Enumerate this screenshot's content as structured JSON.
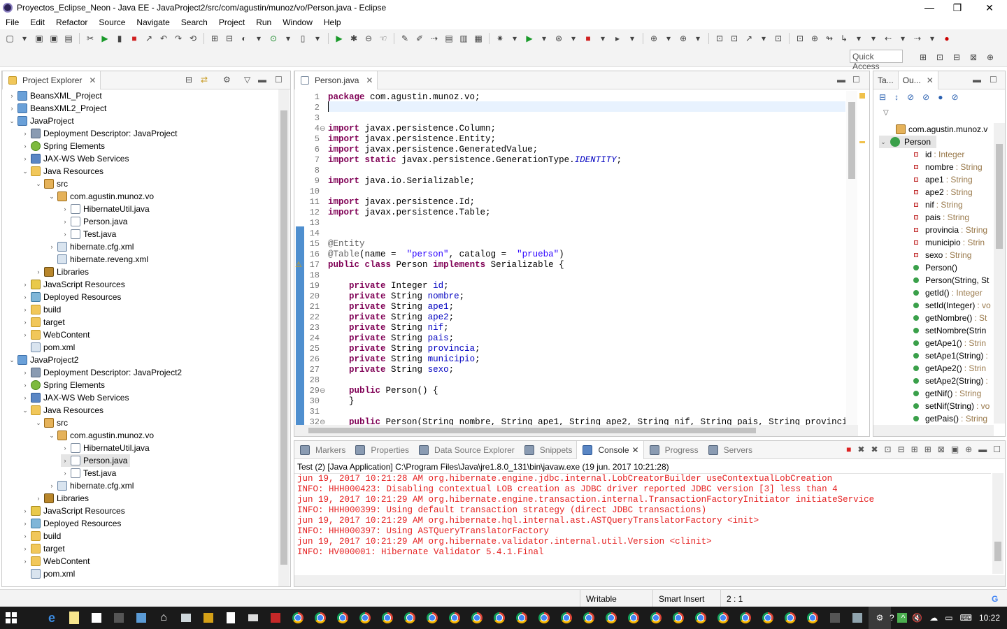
{
  "window": {
    "title": "Proyectos_Eclipse_Neon - Java EE - JavaProject2/src/com/agustin/munoz/vo/Person.java - Eclipse",
    "minimize": "—",
    "maximize": "❐",
    "close": "✕"
  },
  "menu": [
    "File",
    "Edit",
    "Refactor",
    "Source",
    "Navigate",
    "Search",
    "Project",
    "Run",
    "Window",
    "Help"
  ],
  "quick_access": "Quick Access",
  "project_explorer": {
    "tab": "Project Explorer",
    "items": [
      {
        "label": "BeansXML_Project",
        "depth": 0,
        "tw": "›",
        "icon": "proj"
      },
      {
        "label": "BeansXML2_Project",
        "depth": 0,
        "tw": "›",
        "icon": "proj"
      },
      {
        "label": "JavaProject",
        "depth": 0,
        "tw": "⌄",
        "icon": "proj"
      },
      {
        "label": "Deployment Descriptor: JavaProject",
        "depth": 1,
        "tw": "›",
        "icon": "dd"
      },
      {
        "label": "Spring Elements",
        "depth": 1,
        "tw": "›",
        "icon": "spring"
      },
      {
        "label": "JAX-WS Web Services",
        "depth": 1,
        "tw": "›",
        "icon": "ws"
      },
      {
        "label": "Java Resources",
        "depth": 1,
        "tw": "⌄",
        "icon": "folder"
      },
      {
        "label": "src",
        "depth": 2,
        "tw": "⌄",
        "icon": "pkg"
      },
      {
        "label": "com.agustin.munoz.vo",
        "depth": 3,
        "tw": "⌄",
        "icon": "pkg"
      },
      {
        "label": "HibernateUtil.java",
        "depth": 4,
        "tw": "›",
        "icon": "java"
      },
      {
        "label": "Person.java",
        "depth": 4,
        "tw": "›",
        "icon": "java"
      },
      {
        "label": "Test.java",
        "depth": 4,
        "tw": "›",
        "icon": "java"
      },
      {
        "label": "hibernate.cfg.xml",
        "depth": 3,
        "tw": "›",
        "icon": "xml"
      },
      {
        "label": "hibernate.reveng.xml",
        "depth": 3,
        "tw": "",
        "icon": "xml"
      },
      {
        "label": "Libraries",
        "depth": 2,
        "tw": "›",
        "icon": "lib"
      },
      {
        "label": "JavaScript Resources",
        "depth": 1,
        "tw": "›",
        "icon": "js"
      },
      {
        "label": "Deployed Resources",
        "depth": 1,
        "tw": "›",
        "icon": "dep"
      },
      {
        "label": "build",
        "depth": 1,
        "tw": "›",
        "icon": "folder"
      },
      {
        "label": "target",
        "depth": 1,
        "tw": "›",
        "icon": "folder"
      },
      {
        "label": "WebContent",
        "depth": 1,
        "tw": "›",
        "icon": "folder"
      },
      {
        "label": "pom.xml",
        "depth": 1,
        "tw": "",
        "icon": "xml"
      },
      {
        "label": "JavaProject2",
        "depth": 0,
        "tw": "⌄",
        "icon": "proj"
      },
      {
        "label": "Deployment Descriptor: JavaProject2",
        "depth": 1,
        "tw": "›",
        "icon": "dd"
      },
      {
        "label": "Spring Elements",
        "depth": 1,
        "tw": "›",
        "icon": "spring"
      },
      {
        "label": "JAX-WS Web Services",
        "depth": 1,
        "tw": "›",
        "icon": "ws"
      },
      {
        "label": "Java Resources",
        "depth": 1,
        "tw": "⌄",
        "icon": "folder"
      },
      {
        "label": "src",
        "depth": 2,
        "tw": "⌄",
        "icon": "pkg"
      },
      {
        "label": "com.agustin.munoz.vo",
        "depth": 3,
        "tw": "⌄",
        "icon": "pkg"
      },
      {
        "label": "HibernateUtil.java",
        "depth": 4,
        "tw": "›",
        "icon": "java"
      },
      {
        "label": "Person.java",
        "depth": 4,
        "tw": "›",
        "icon": "java",
        "selected": true
      },
      {
        "label": "Test.java",
        "depth": 4,
        "tw": "›",
        "icon": "java"
      },
      {
        "label": "hibernate.cfg.xml",
        "depth": 3,
        "tw": "›",
        "icon": "xml"
      },
      {
        "label": "Libraries",
        "depth": 2,
        "tw": "›",
        "icon": "lib"
      },
      {
        "label": "JavaScript Resources",
        "depth": 1,
        "tw": "›",
        "icon": "js"
      },
      {
        "label": "Deployed Resources",
        "depth": 1,
        "tw": "›",
        "icon": "dep"
      },
      {
        "label": "build",
        "depth": 1,
        "tw": "›",
        "icon": "folder"
      },
      {
        "label": "target",
        "depth": 1,
        "tw": "›",
        "icon": "folder"
      },
      {
        "label": "WebContent",
        "depth": 1,
        "tw": "›",
        "icon": "folder"
      },
      {
        "label": "pom.xml",
        "depth": 1,
        "tw": "",
        "icon": "xml"
      }
    ]
  },
  "editor": {
    "tab": "Person.java",
    "lines": [
      [
        [
          "kw",
          "package"
        ],
        [
          "",
          "com.agustin.munoz.vo;"
        ]
      ],
      [],
      [],
      [
        [
          "kw",
          "import"
        ],
        [
          "",
          "javax.persistence.Column;"
        ]
      ],
      [
        [
          "kw",
          "import"
        ],
        [
          "",
          "javax.persistence.Entity;"
        ]
      ],
      [
        [
          "kw",
          "import"
        ],
        [
          "",
          "javax.persistence.GeneratedValue;"
        ]
      ],
      [
        [
          "kw",
          "import"
        ],
        [
          "kw",
          "static"
        ],
        [
          "",
          "javax.persistence.GenerationType."
        ],
        [
          "ital",
          "IDENTITY"
        ],
        [
          "",
          ";"
        ]
      ],
      [],
      [
        [
          "kw",
          "import"
        ],
        [
          "",
          "java.io.Serializable;"
        ]
      ],
      [],
      [
        [
          "kw",
          "import"
        ],
        [
          "",
          "javax.persistence.Id;"
        ]
      ],
      [
        [
          "kw",
          "import"
        ],
        [
          "",
          "javax.persistence.Table;"
        ]
      ],
      [],
      [],
      [
        [
          "ann",
          "@Entity"
        ]
      ],
      [
        [
          "ann",
          "@Table"
        ],
        [
          "",
          "(name = "
        ],
        [
          "str",
          "\"person\""
        ],
        [
          "",
          ", catalog = "
        ],
        [
          "str",
          "\"prueba\""
        ],
        [
          "",
          ")"
        ]
      ],
      [
        [
          "kw",
          "public class"
        ],
        [
          "",
          "Person"
        ],
        [
          "kw",
          "implements"
        ],
        [
          "",
          "Serializable {"
        ]
      ],
      [],
      [
        [
          "",
          "    "
        ],
        [
          "kw",
          "private"
        ],
        [
          "",
          "Integer"
        ],
        [
          "fld",
          "id"
        ],
        [
          "",
          ";"
        ]
      ],
      [
        [
          "",
          "    "
        ],
        [
          "kw",
          "private"
        ],
        [
          "",
          "String"
        ],
        [
          "fld",
          "nombre"
        ],
        [
          "",
          ";"
        ]
      ],
      [
        [
          "",
          "    "
        ],
        [
          "kw",
          "private"
        ],
        [
          "",
          "String"
        ],
        [
          "fld",
          "ape1"
        ],
        [
          "",
          ";"
        ]
      ],
      [
        [
          "",
          "    "
        ],
        [
          "kw",
          "private"
        ],
        [
          "",
          "String"
        ],
        [
          "fld",
          "ape2"
        ],
        [
          "",
          ";"
        ]
      ],
      [
        [
          "",
          "    "
        ],
        [
          "kw",
          "private"
        ],
        [
          "",
          "String"
        ],
        [
          "fld",
          "nif"
        ],
        [
          "",
          ";"
        ]
      ],
      [
        [
          "",
          "    "
        ],
        [
          "kw",
          "private"
        ],
        [
          "",
          "String"
        ],
        [
          "fld",
          "pais"
        ],
        [
          "",
          ";"
        ]
      ],
      [
        [
          "",
          "    "
        ],
        [
          "kw",
          "private"
        ],
        [
          "",
          "String"
        ],
        [
          "fld",
          "provincia"
        ],
        [
          "",
          ";"
        ]
      ],
      [
        [
          "",
          "    "
        ],
        [
          "kw",
          "private"
        ],
        [
          "",
          "String"
        ],
        [
          "fld",
          "municipio"
        ],
        [
          "",
          ";"
        ]
      ],
      [
        [
          "",
          "    "
        ],
        [
          "kw",
          "private"
        ],
        [
          "",
          "String"
        ],
        [
          "fld",
          "sexo"
        ],
        [
          "",
          ";"
        ]
      ],
      [],
      [
        [
          "",
          "    "
        ],
        [
          "kw",
          "public"
        ],
        [
          "",
          "Person() {"
        ]
      ],
      [
        [
          "",
          "    }"
        ]
      ],
      [],
      [
        [
          "",
          "    "
        ],
        [
          "kw",
          "public"
        ],
        [
          "",
          "Person(String nombre, String ape1, String ape2, String nif, String pais, String provincia, Stri"
        ]
      ]
    ]
  },
  "outline": {
    "tab_tasks": "Ta...",
    "tab": "Ou...",
    "package": "com.agustin.munoz.v",
    "class": "Person",
    "members": [
      {
        "kind": "field",
        "name": "id",
        "type": ": Integer"
      },
      {
        "kind": "field",
        "name": "nombre",
        "type": ": String"
      },
      {
        "kind": "field",
        "name": "ape1",
        "type": ": String"
      },
      {
        "kind": "field",
        "name": "ape2",
        "type": ": String"
      },
      {
        "kind": "field",
        "name": "nif",
        "type": ": String"
      },
      {
        "kind": "field",
        "name": "pais",
        "type": ": String"
      },
      {
        "kind": "field",
        "name": "provincia",
        "type": ": String"
      },
      {
        "kind": "field",
        "name": "municipio",
        "type": ": Strin"
      },
      {
        "kind": "field",
        "name": "sexo",
        "type": ": String"
      },
      {
        "kind": "ctor",
        "name": "Person()",
        "type": ""
      },
      {
        "kind": "ctor",
        "name": "Person(String, St",
        "type": ""
      },
      {
        "kind": "method",
        "name": "getId()",
        "type": ": Integer"
      },
      {
        "kind": "method",
        "name": "setId(Integer)",
        "type": ": vo"
      },
      {
        "kind": "method",
        "name": "getNombre()",
        "type": ": St"
      },
      {
        "kind": "method",
        "name": "setNombre(Strin",
        "type": ""
      },
      {
        "kind": "method",
        "name": "getApe1()",
        "type": ": Strin"
      },
      {
        "kind": "method",
        "name": "setApe1(String)",
        "type": ":"
      },
      {
        "kind": "method",
        "name": "getApe2()",
        "type": ": Strin"
      },
      {
        "kind": "method",
        "name": "setApe2(String)",
        "type": ":"
      },
      {
        "kind": "method",
        "name": "getNif()",
        "type": ": String"
      },
      {
        "kind": "method",
        "name": "setNif(String)",
        "type": ": vo"
      },
      {
        "kind": "method",
        "name": "getPais()",
        "type": ": String"
      }
    ]
  },
  "console": {
    "tabs": [
      "Markers",
      "Properties",
      "Data Source Explorer",
      "Snippets",
      "Console",
      "Progress",
      "Servers"
    ],
    "active_tab": "Console",
    "header": "Test (2) [Java Application] C:\\Program Files\\Java\\jre1.8.0_131\\bin\\javaw.exe (19 jun. 2017 10:21:28)",
    "lines": [
      "jun 19, 2017 10:21:28 AM org.hibernate.engine.jdbc.internal.LobCreatorBuilder useContextualLobCreation",
      "INFO: HHH000423: Disabling contextual LOB creation as JDBC driver reported JDBC version [3] less than 4",
      "jun 19, 2017 10:21:29 AM org.hibernate.engine.transaction.internal.TransactionFactoryInitiator initiateService",
      "INFO: HHH000399: Using default transaction strategy (direct JDBC transactions)",
      "jun 19, 2017 10:21:29 AM org.hibernate.hql.internal.ast.ASTQueryTranslatorFactory <init>",
      "INFO: HHH000397: Using ASTQueryTranslatorFactory",
      "jun 19, 2017 10:21:29 AM org.hibernate.validator.internal.util.Version <clinit>",
      "INFO: HV000001: Hibernate Validator 5.4.1.Final"
    ]
  },
  "status": {
    "writable": "Writable",
    "insert_mode": "Smart Insert",
    "position": "2 : 1"
  },
  "taskbar": {
    "time": "10:22"
  }
}
